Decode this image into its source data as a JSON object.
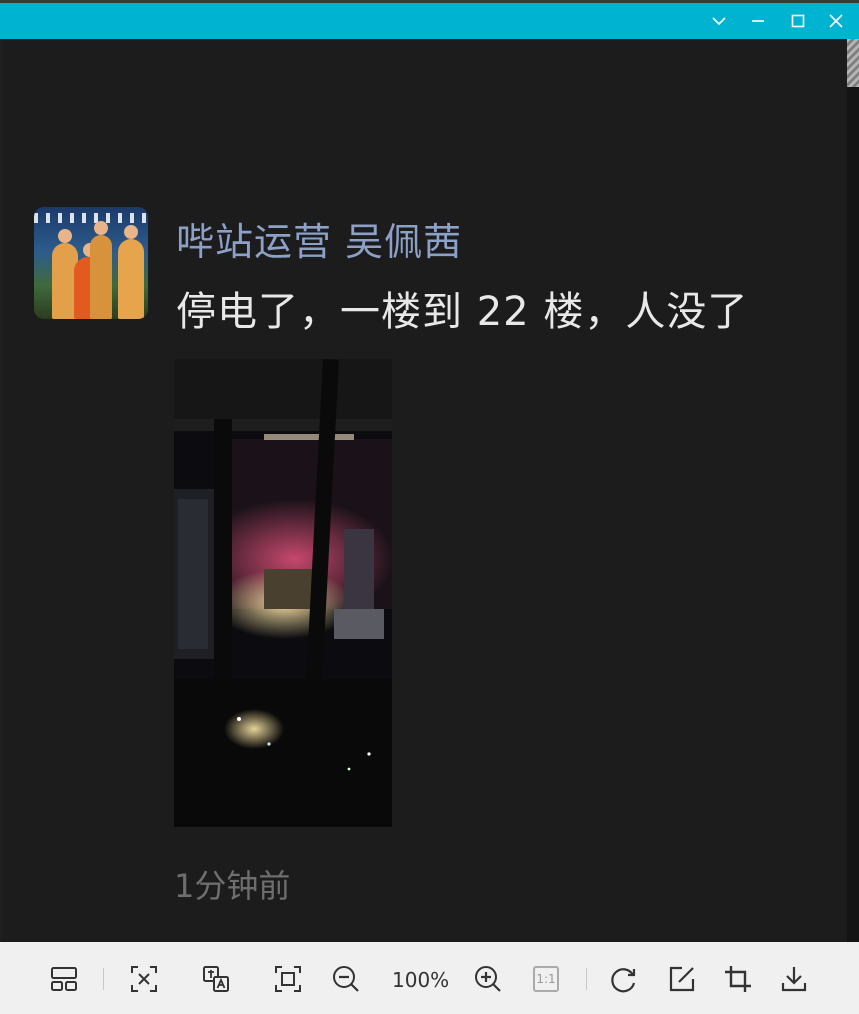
{
  "window": {
    "controls": [
      "chevron-down-icon",
      "minimize-icon",
      "maximize-icon",
      "close-icon"
    ]
  },
  "post": {
    "author": "哔站运营 吴佩茜",
    "message": "停电了，一楼到 22 楼，人没了",
    "timestamp": "1分钟前"
  },
  "toolbar": {
    "zoom": "100%",
    "actual_size_label": "1:1",
    "icons": [
      "thumbnails-icon",
      "fit-window-icon",
      "translate-text-icon",
      "fullscreen-icon",
      "zoom-out-icon",
      "zoom-in-icon",
      "actual-size-icon",
      "rotate-icon",
      "edit-icon",
      "crop-icon",
      "download-icon"
    ]
  },
  "colors": {
    "titlebar": "#00b4d1",
    "background": "#1c1c1c",
    "author": "#8ca0c8",
    "message": "#e8e8e8",
    "timestamp": "#6e6e6e",
    "toolbar": "#f0f0f0"
  }
}
